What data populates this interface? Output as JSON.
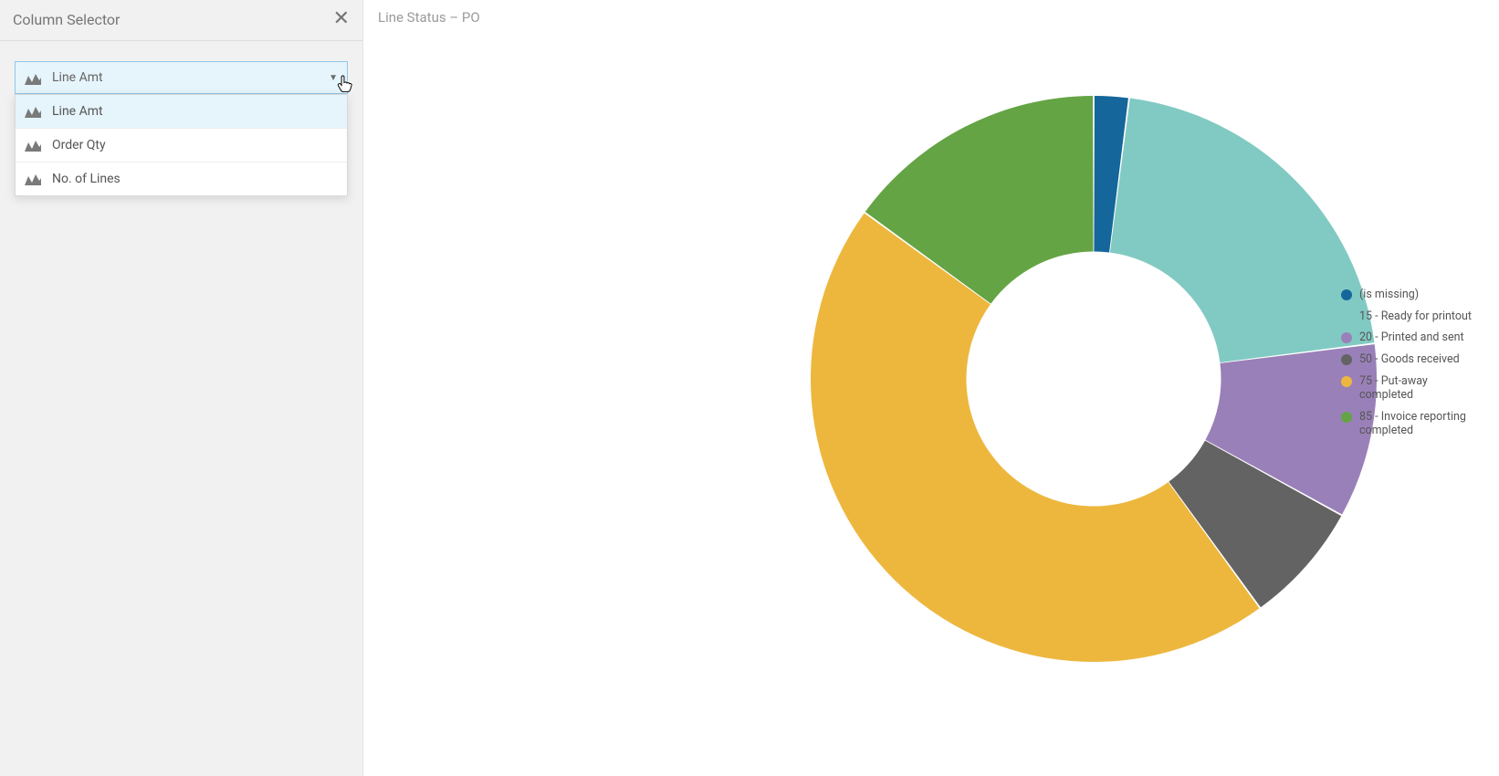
{
  "sidebar": {
    "title": "Column Selector",
    "selected_value": "Line Amt",
    "options": [
      "Line Amt",
      "Order Qty",
      "No. of Lines"
    ]
  },
  "chart": {
    "title": "Line Status – PO"
  },
  "legend": [
    {
      "label": "(is missing)",
      "color": "#15669b"
    },
    {
      "label": "15 - Ready for printout",
      "color": "#81cac3"
    },
    {
      "label": "20 - Printed and sent",
      "color": "#9a80b8"
    },
    {
      "label": "50 - Goods received",
      "color": "#636363"
    },
    {
      "label": "75 - Put-away completed",
      "color": "#edb73e"
    },
    {
      "label": "85 - Invoice reporting completed",
      "color": "#64a444"
    }
  ],
  "chart_data": {
    "type": "pie",
    "title": "Line Status – PO",
    "hole": 0.45,
    "series": [
      {
        "name": "(is missing)",
        "value": 2,
        "color": "#15669b"
      },
      {
        "name": "15 - Ready for printout",
        "value": 21,
        "color": "#81cac3"
      },
      {
        "name": "20 - Printed and sent",
        "value": 10,
        "color": "#9a80b8"
      },
      {
        "name": "50 - Goods received",
        "value": 7,
        "color": "#636363"
      },
      {
        "name": "75 - Put-away completed",
        "value": 45,
        "color": "#edb73e"
      },
      {
        "name": "85 - Invoice reporting completed",
        "value": 15,
        "color": "#64a444"
      }
    ],
    "note": "values are approximate percentage shares read from the donut chart"
  }
}
